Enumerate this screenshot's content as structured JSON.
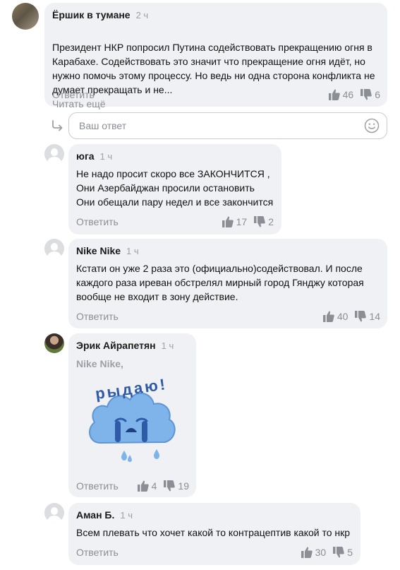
{
  "comments": [
    {
      "author": "Ёршик в тумане",
      "time": "2 ч",
      "text": "Президент НКР попросил Путина содействовать прекращению огня в\nКарабахе. Содействовать это значит что прекращение огня идёт, но\nнужно помочь этому процессу. Но ведь ни одна сторона конфликта не\nдумает прекращать  и не...",
      "more": "Читать ещё",
      "reply": "Ответить",
      "likes": "46",
      "dislikes": "6"
    },
    {
      "author": "юга",
      "time": "1 ч",
      "text": "Не надо просит скоро все ЗАКОНЧИТСЯ ,\nОни Азербайджан просили остановить\nОни обещали пару недел и все закончится",
      "reply": "Ответить",
      "likes": "17",
      "dislikes": "2"
    },
    {
      "author": "Nike Nike",
      "time": "1 ч",
      "text": "Кстати он уже 2 раза это (официально)содействовал. И после\nкаждого раза иреван обстрелял мирный город Гянджу которая\nвообще не входит в зону действие.",
      "reply": "Ответить",
      "likes": "40",
      "dislikes": "14"
    },
    {
      "author": "Эрик Айрапетян",
      "time": "1 ч",
      "mention": "Nike Nike,",
      "sticker_text": "рыдаю!",
      "reply": "Ответить",
      "likes": "4",
      "dislikes": "19"
    },
    {
      "author": "Аман Б.",
      "time": "1 ч",
      "text": "Всем плевать что хочет какой то контрацептив какой то нкр",
      "reply": "Ответить",
      "likes": "30",
      "dislikes": "5"
    }
  ],
  "reply_box": {
    "placeholder": "Ваш ответ"
  },
  "colors": {
    "bubble": "#f0f1f4",
    "muted": "#8b8e95",
    "sticker_cloud": "#7fb4ea",
    "sticker_text": "#2f5aa8"
  },
  "icons": [
    "thumb-up-icon",
    "thumb-down-icon",
    "reply-arrow-icon",
    "emoji-icon"
  ]
}
